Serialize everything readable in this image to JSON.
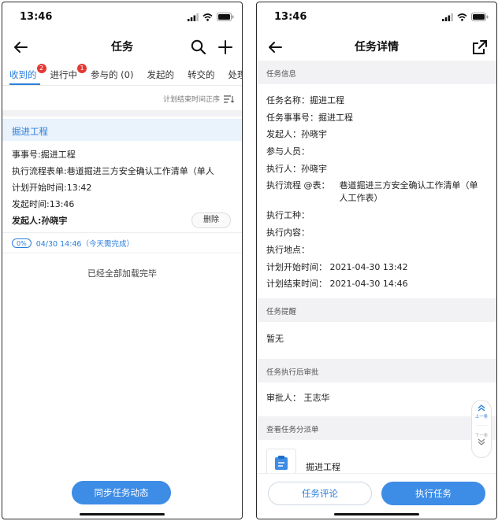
{
  "left": {
    "status_time": "13:46",
    "title": "任务",
    "tabs": [
      {
        "label": "收到的",
        "badge": "2"
      },
      {
        "label": "进行中",
        "badge": "1"
      },
      {
        "label": "参与的 (0)",
        "badge": ""
      },
      {
        "label": "发起的",
        "badge": ""
      },
      {
        "label": "转交的",
        "badge": ""
      },
      {
        "label": "处理的",
        "badge": ""
      }
    ],
    "sort_label": "计划结束时间正序",
    "task": {
      "name": "掘进工程",
      "item_no": "事事号:掘进工程",
      "flow_form": "执行流程表单:巷道掘进三方安全确认工作清单（单人",
      "plan_start": "计划开始时间:13:42",
      "start_time": "发起时间:13:46",
      "initiator": "发起人:孙晓宇",
      "delete_label": "删除",
      "progress": "0%",
      "deadline": "04/30 14:46（今天需完成）"
    },
    "loaded_text": "已经全部加载完毕",
    "sync_label": "同步任务动态"
  },
  "right": {
    "status_time": "13:46",
    "title": "任务详情",
    "sections": {
      "info": "任务信息",
      "reminder": "任务提醒",
      "approval": "任务执行后审批",
      "dispatch": "查看任务分派单"
    },
    "info_lines": [
      "任务名称：掘进工程",
      "任务事事号：掘进工程",
      "发起人：孙晓宇",
      "参与人员：",
      "执行人：孙晓宇"
    ],
    "flow_key": "执行流程 @表：",
    "flow_value": "巷道掘进三方安全确认工作清单（单人工作表）",
    "info_lines_2": [
      "执行工种：",
      "执行内容：",
      "执行地点：",
      "计划开始时间：  2021-04-30 13:42",
      "计划结束时间：  2021-04-30 14:46"
    ],
    "reminder_value": "暂无",
    "approver": "审批人：  王志华",
    "dispatch_item": "掘进工程",
    "float_prev": "上一条",
    "float_sep": "- - - -",
    "float_next": "下一条",
    "comment_label": "任务评论",
    "execute_label": "执行任务"
  }
}
